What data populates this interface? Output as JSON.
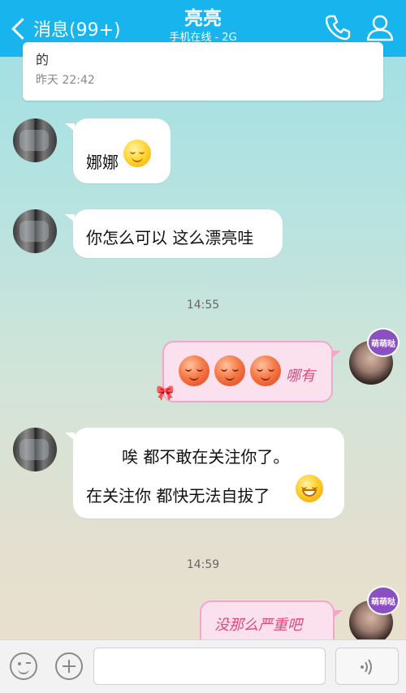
{
  "header": {
    "back_label": "消息(99+)",
    "title": "亮亮",
    "subtitle": "手机在线 - 2G",
    "icons": [
      "phone-icon",
      "contact-icon"
    ],
    "color": "#18b4ed"
  },
  "top_card": {
    "text_fragment": "的",
    "time": "昨天 22:42"
  },
  "messages": [
    {
      "side": "left",
      "text": "娜娜",
      "emoji": "smile"
    },
    {
      "side": "left",
      "text": "你怎么可以 这么漂亮哇"
    },
    {
      "type": "time",
      "text": "14:55"
    },
    {
      "side": "right",
      "text": "哪有",
      "emoji": "three-red-faces"
    },
    {
      "side": "left",
      "lines": [
        "唉   都不敢在关注你了。",
        "在关注你  都快无法自拔了"
      ],
      "emoji": "laugh"
    },
    {
      "type": "time",
      "text": "14:59"
    },
    {
      "side": "right",
      "text": "没那么严重吧"
    }
  ],
  "right_avatar_badge": "萌萌哒",
  "input": {
    "placeholder": "",
    "value": ""
  },
  "colors": {
    "bubble": "#ffffff",
    "pink_bubble": "#fbe0ee",
    "pink_border": "#f2a6c9",
    "pink_text": "#e0497a"
  }
}
